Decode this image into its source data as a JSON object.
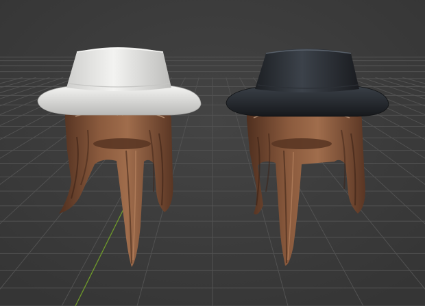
{
  "viewport": {
    "background": "#3d3d3d",
    "grid_color": "#525252",
    "y_axis_color": "#6f9a2a"
  },
  "models": [
    {
      "name": "white-hat-hair-model",
      "hat_color": "#e4e4e2",
      "hair_color": "#7a4c33"
    },
    {
      "name": "black-hat-hair-model",
      "hat_color": "#262a2e",
      "hair_color": "#7a4c33"
    }
  ]
}
